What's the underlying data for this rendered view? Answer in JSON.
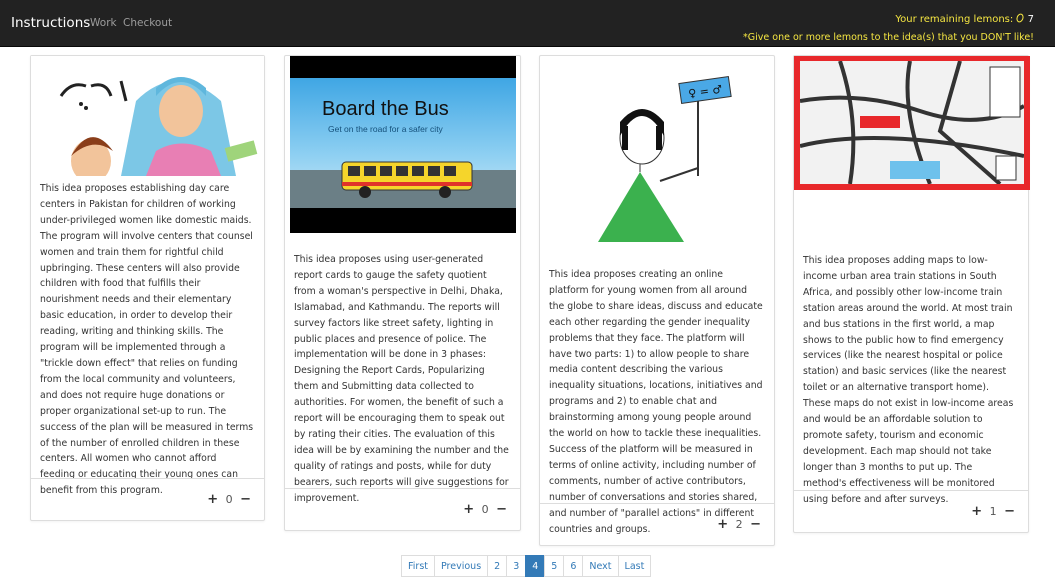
{
  "nav": {
    "brand": "Instructions",
    "links": [
      "Work",
      "Checkout"
    ],
    "lemons_label": "Your remaining lemons:",
    "lemons_count": "7",
    "hint": "*Give one or more lemons to the idea(s) that you DON'T like!"
  },
  "cards": [
    {
      "image_alt": "woman-and-child-illustration",
      "text": "This idea proposes establishing day care centers in Pakistan for children of working under-privileged women like domestic maids. The program will involve centers that counsel women and train them for rightful child upbringing. These centers will also provide children with food that fulfills their nourishment needs and their elementary basic education, in order to develop their reading, writing and thinking skills. The program will be implemented through a \"trickle down effect\" that relies on funding from the local community and volunteers, and does not require huge donations or proper organizational set-up to run. The success of the plan will be measured in terms of the number of enrolled children in these centers. All women who cannot afford feeding or educating their young ones can benefit from this program.",
      "votes": "0"
    },
    {
      "image_title": "Board the Bus",
      "image_subtitle": "Get on the road for a safer city",
      "text": "This idea proposes using user-generated report cards to gauge the safety quotient from a woman's perspective in Delhi, Dhaka, Islamabad, and Kathmandu. The reports will survey factors like street safety, lighting in public places and presence of police. The implementation will be done in 3 phases: Designing the Report Cards, Popularizing them and Submitting data collected to authorities. For women, the benefit of such a report will be encouraging them to speak out by rating their cities. The evaluation of this idea will be by examining the number and the quality of ratings and posts, while for duty bearers, such reports will give suggestions for improvement.",
      "votes": "0"
    },
    {
      "image_sign": "♀ = ♂",
      "text": "This idea proposes creating an online platform for young women from all around the globe to share ideas, discuss and educate each other regarding the gender inequality problems that they face. The platform will have two parts: 1) to allow people to share media content describing the various inequality situations, locations, initiatives and programs and 2) to enable chat and brainstorming among young people around the world on how to tackle these inequalities. Success of the platform will be measured in terms of online activity, including number of comments, number of active contributors, number of conversations and stories shared, and number of \"parallel actions\" in different countries and groups.",
      "votes": "2"
    },
    {
      "image_alt": "train-station-map",
      "text": "This idea proposes adding maps to low-income urban area train stations in South Africa, and possibly other low-income train station areas around the world. At most train and bus stations in the first world, a map shows to the public how to find emergency services (like the nearest hospital or police station) and basic services (like the nearest toilet or an alternative transport home). These maps do not exist in low-income areas and would be an affordable solution to promote safety, tourism and economic development. Each map should not take longer than 3 months to put up. The method's effectiveness will be monitored using before and after surveys.",
      "votes": "1"
    }
  ],
  "vote_plus": "+",
  "vote_minus": "−",
  "pagination": [
    "First",
    "Previous",
    "2",
    "3",
    "4",
    "5",
    "6",
    "Next",
    "Last"
  ],
  "pagination_active": "4"
}
